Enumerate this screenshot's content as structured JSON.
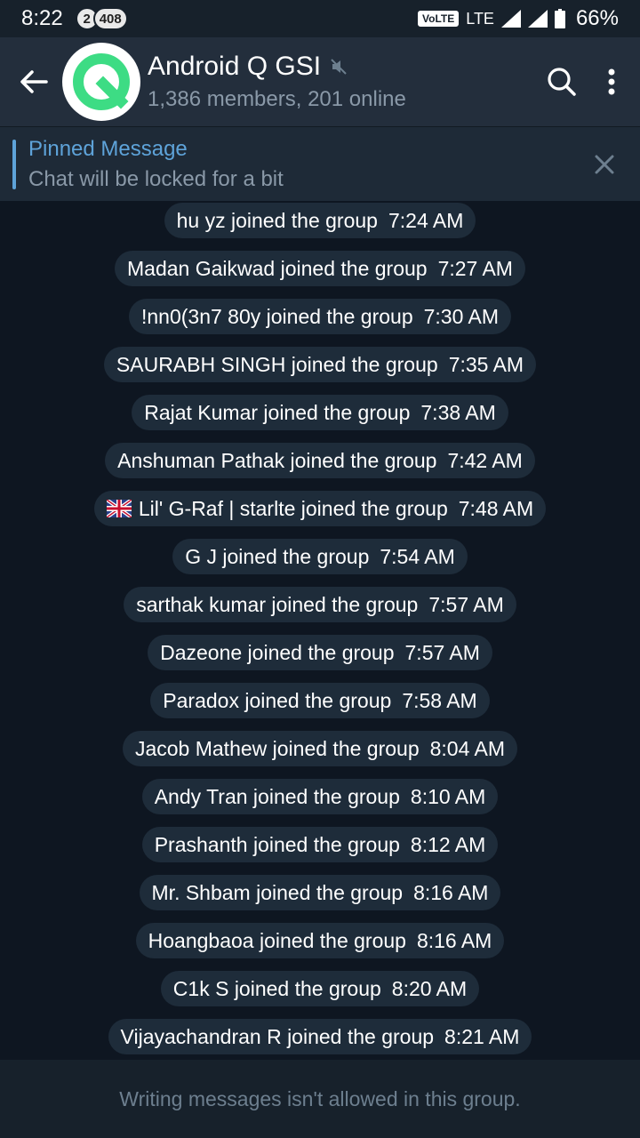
{
  "status_bar": {
    "time": "8:22",
    "badges": [
      "2",
      "408"
    ],
    "volte": "VoLTE",
    "network": "LTE",
    "battery": "66%"
  },
  "header": {
    "title": "Android Q GSI",
    "subtitle": "1,386 members, 201 online",
    "icons": [
      "back-arrow-icon",
      "mute-icon",
      "search-icon",
      "more-vert-icon"
    ]
  },
  "pinned": {
    "title": "Pinned Message",
    "message": "Chat will be locked for a bit"
  },
  "messages": [
    {
      "text": "hu yz joined the group",
      "time": "7:24 AM"
    },
    {
      "text": "Madan Gaikwad joined the group",
      "time": "7:27 AM"
    },
    {
      "text": "!nn0(3n7 80y joined the group",
      "time": "7:30 AM"
    },
    {
      "text": "SAURABH SINGH joined the group",
      "time": "7:35 AM"
    },
    {
      "text": "Rajat Kumar joined the group",
      "time": "7:38 AM"
    },
    {
      "text": "Anshuman Pathak joined the group",
      "time": "7:42 AM"
    },
    {
      "text": "Lil' G-Raf | starlte joined the group",
      "time": "7:48 AM"
    },
    {
      "text": "G J joined the group",
      "time": "7:54 AM"
    },
    {
      "text": "sarthak kumar joined the group",
      "time": "7:57 AM"
    },
    {
      "text": "Dazeone joined the group",
      "time": "7:57 AM"
    },
    {
      "text": "Paradox joined the group",
      "time": "7:58 AM"
    },
    {
      "text": "Jacob Mathew joined the group",
      "time": "8:04 AM"
    },
    {
      "text": "Andy Tran joined the group",
      "time": "8:10 AM"
    },
    {
      "text": "Prashanth joined the group",
      "time": "8:12 AM"
    },
    {
      "text": "Mr. Shbam joined the group",
      "time": "8:16 AM"
    },
    {
      "text": "Hoangbaoa joined the group",
      "time": "8:16 AM"
    },
    {
      "text": "C1k S joined the group",
      "time": "8:20 AM"
    },
    {
      "text": "Vijayachandran R joined the group",
      "time": "8:21 AM"
    }
  ],
  "composer": {
    "notice": "Writing messages isn't allowed in this group."
  },
  "colors": {
    "accent": "#5ea3d9",
    "header_bg": "#232e3c",
    "chat_bg": "#0e1621",
    "service_bubble": "#1e2c3a",
    "android_green": "#3ddc84"
  }
}
